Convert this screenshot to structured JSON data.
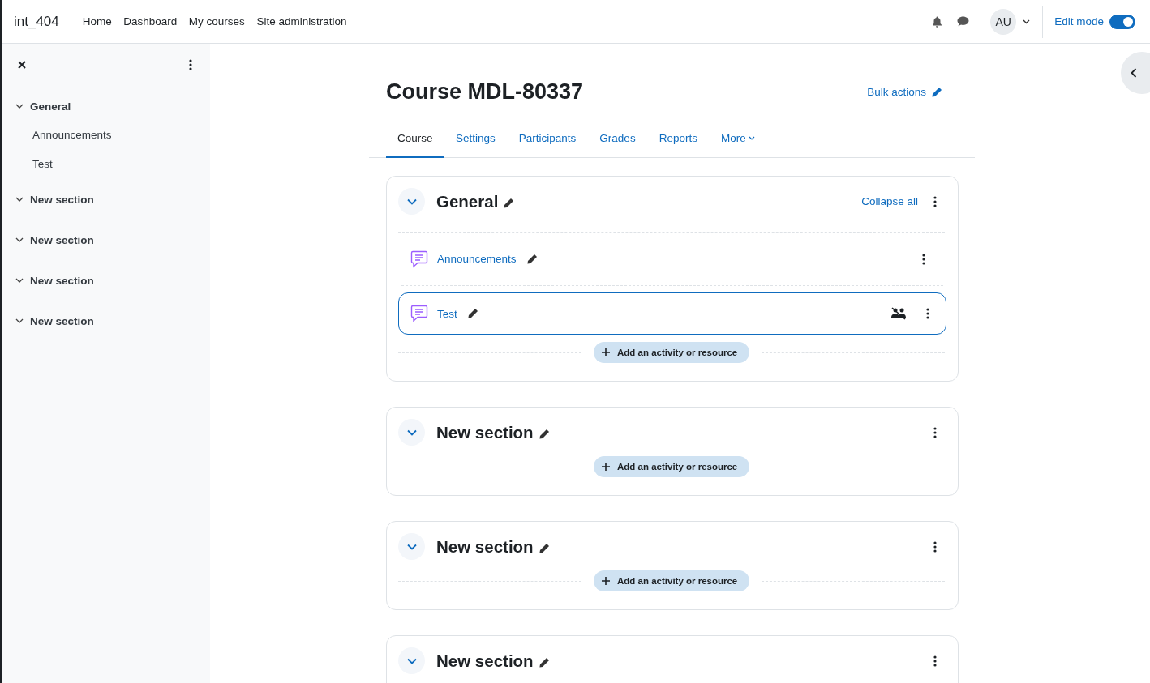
{
  "navbar": {
    "site_name": "int_404",
    "links": [
      "Home",
      "Dashboard",
      "My courses",
      "Site administration"
    ],
    "avatar": "AU",
    "edit_mode": {
      "label": "Edit mode",
      "on": true
    }
  },
  "course_index": {
    "items": [
      {
        "title": "General",
        "expanded": true,
        "children": [
          {
            "title": "Announcements"
          },
          {
            "title": "Test"
          }
        ]
      },
      {
        "title": "New section",
        "expanded": true
      },
      {
        "title": "New section",
        "expanded": true
      },
      {
        "title": "New section",
        "expanded": true
      },
      {
        "title": "New section",
        "expanded": true
      }
    ]
  },
  "page": {
    "title": "Course MDL-80337",
    "bulk_actions": "Bulk actions",
    "tabs": [
      {
        "label": "Course",
        "selected": true,
        "dropdown": false
      },
      {
        "label": "Settings",
        "selected": false,
        "dropdown": false
      },
      {
        "label": "Participants",
        "selected": false,
        "dropdown": false
      },
      {
        "label": "Grades",
        "selected": false,
        "dropdown": false
      },
      {
        "label": "Reports",
        "selected": false,
        "dropdown": false
      },
      {
        "label": "More",
        "selected": false,
        "dropdown": true
      }
    ],
    "collapse_all": "Collapse all",
    "sections": [
      {
        "title": "General",
        "activities": [
          {
            "name": "Announcements",
            "selected": false,
            "groups_hidden": false
          },
          {
            "name": "Test",
            "selected": true,
            "groups_hidden": true
          }
        ],
        "add_label": "Add an activity or resource"
      },
      {
        "title": "New section",
        "add_label": "Add an activity or resource"
      },
      {
        "title": "New section",
        "add_label": "Add an activity or resource"
      },
      {
        "title": "New section"
      }
    ]
  }
}
